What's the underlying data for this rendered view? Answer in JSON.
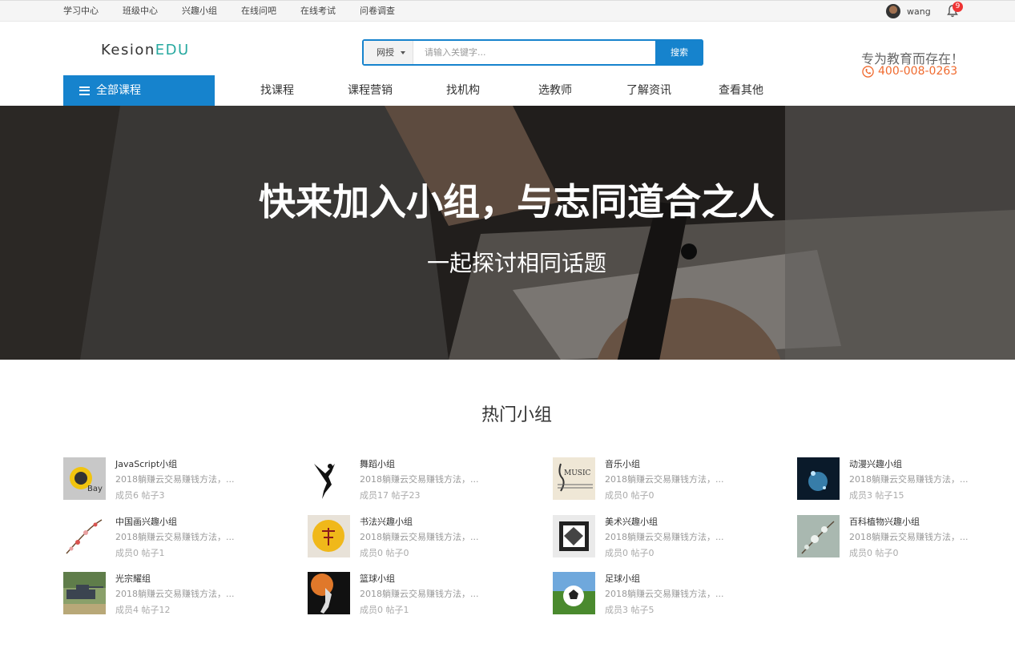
{
  "topbar": {
    "links": [
      "学习中心",
      "班级中心",
      "兴趣小组",
      "在线问吧",
      "在线考试",
      "问卷调查"
    ],
    "username": "wang",
    "notification_count": "9"
  },
  "header": {
    "logo_part1": "Kesion",
    "logo_part2": "EDU",
    "search_scope": "网授",
    "search_placeholder": "请输入关键字...",
    "search_button": "搜索",
    "slogan": "专为教育而存在！",
    "phone": "400-008-0263"
  },
  "nav": {
    "all_courses": "全部课程",
    "items": [
      "找课程",
      "课程营销",
      "找机构",
      "选教师",
      "了解资讯",
      "查看其他"
    ]
  },
  "hero": {
    "title": "快来加入小组，与志同道合之人",
    "subtitle": "一起探讨相同话题"
  },
  "section": {
    "title": "热门小组"
  },
  "groups": [
    {
      "name": "JavaScript小组",
      "desc": "2018躺赚云交易赚钱方法，...",
      "stats": "成员6 帖子3"
    },
    {
      "name": "舞蹈小组",
      "desc": "2018躺赚云交易赚钱方法，...",
      "stats": "成员17 帖子23"
    },
    {
      "name": "音乐小组",
      "desc": "2018躺赚云交易赚钱方法，...",
      "stats": "成员0 帖子0"
    },
    {
      "name": "动漫兴趣小组",
      "desc": "2018躺赚云交易赚钱方法，...",
      "stats": "成员3 帖子15"
    },
    {
      "name": "中国画兴趣小组",
      "desc": "2018躺赚云交易赚钱方法，...",
      "stats": "成员0 帖子1"
    },
    {
      "name": "书法兴趣小组",
      "desc": "2018躺赚云交易赚钱方法，...",
      "stats": "成员0 帖子0"
    },
    {
      "name": "美术兴趣小组",
      "desc": "2018躺赚云交易赚钱方法，...",
      "stats": "成员0 帖子0"
    },
    {
      "name": "百科植物兴趣小组",
      "desc": "2018躺赚云交易赚钱方法，...",
      "stats": "成员0 帖子0"
    },
    {
      "name": "光宗耀组",
      "desc": "2018躺赚云交易赚钱方法，...",
      "stats": "成员4 帖子12"
    },
    {
      "name": "篮球小组",
      "desc": "2018躺赚云交易赚钱方法，...",
      "stats": "成员0 帖子1"
    },
    {
      "name": "足球小组",
      "desc": "2018躺赚云交易赚钱方法，...",
      "stats": "成员3 帖子5"
    }
  ],
  "colors": {
    "primary": "#1683cd",
    "accent_orange": "#f06a2e",
    "logo_green": "#27a9a0"
  },
  "icons": [
    "bell-icon",
    "menu-icon",
    "phone-icon",
    "caret-down-icon"
  ]
}
